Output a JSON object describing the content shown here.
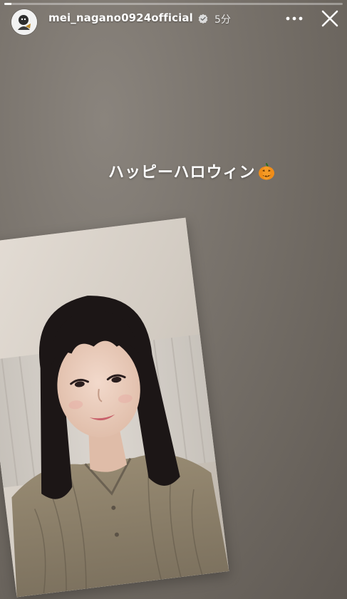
{
  "story": {
    "progress": 0.02,
    "account": {
      "username": "mei_nagano0924official",
      "verified_icon": "verified-badge-icon",
      "timestamp": "5分"
    },
    "controls": {
      "more_icon": "more-options-icon",
      "close_icon": "close-icon"
    },
    "caption": {
      "text": "ハッピーハロウィン",
      "emoji_icon": "jack-o-lantern-icon"
    },
    "photo": {
      "description_icon": "portrait-photo"
    }
  }
}
